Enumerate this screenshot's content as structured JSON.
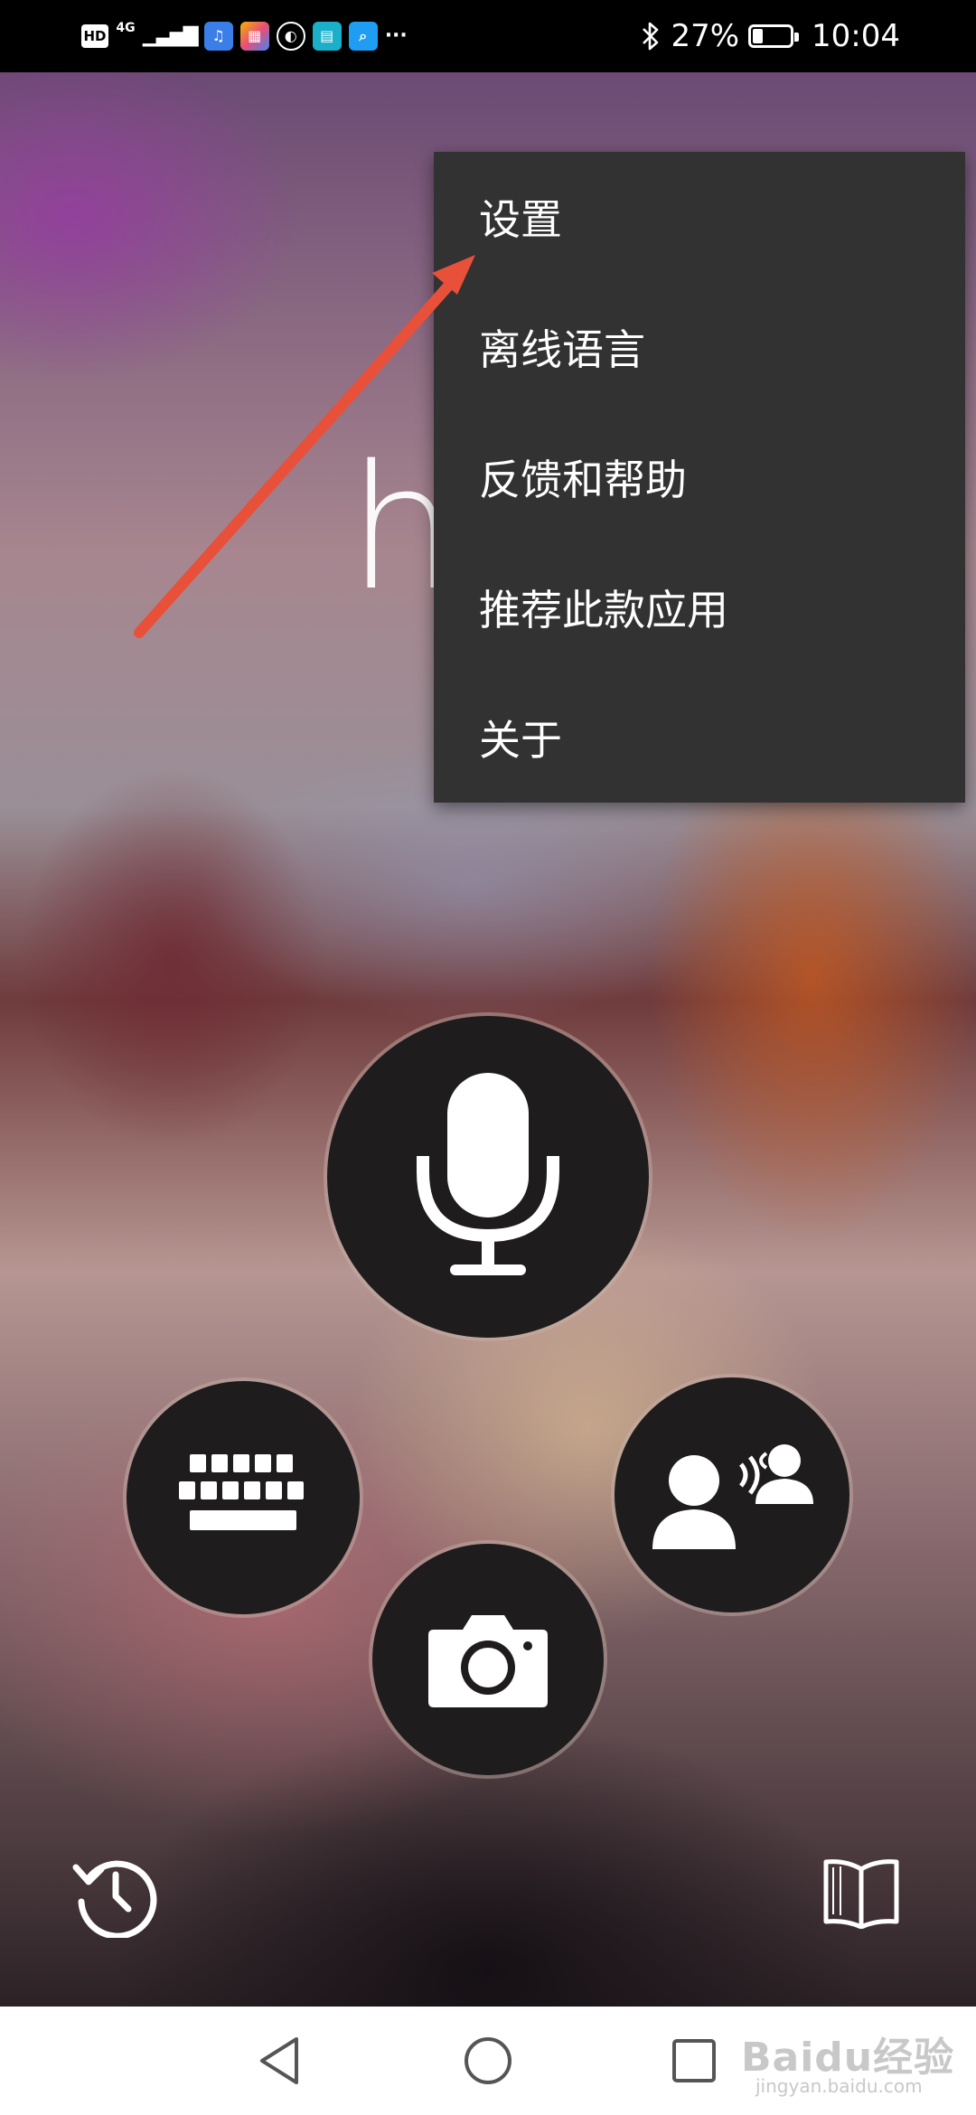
{
  "status_bar": {
    "hd_label": "HD",
    "network_label": "4G",
    "signal_label": "▁▃▅▇",
    "more_label": "···",
    "battery_label": "27%",
    "battery_level": 0.27,
    "time_label": "10:04",
    "bluetooth_glyph": "✱",
    "app_icons": [
      "music-app-icon",
      "app-store-icon",
      "browser-icon",
      "reader-app-icon",
      "search-app-icon"
    ]
  },
  "main": {
    "greeting": "h"
  },
  "menu": {
    "items": [
      {
        "label": "设置"
      },
      {
        "label": "离线语言"
      },
      {
        "label": "反馈和帮助"
      },
      {
        "label": "推荐此款应用"
      },
      {
        "label": "关于"
      }
    ]
  },
  "actions": {
    "icons": [
      "microphone-icon",
      "keyboard-icon",
      "conversation-icon",
      "camera-icon"
    ]
  },
  "bottom": {
    "icons": [
      "history-icon",
      "phrasebook-icon"
    ]
  },
  "watermark": {
    "label": "Baidu经验",
    "sub_label": "jingyan.baidu.com"
  },
  "colors": {
    "menu_bg": "#323232",
    "arrow": "#e8503a",
    "button_bg": "#1e1c1d"
  }
}
